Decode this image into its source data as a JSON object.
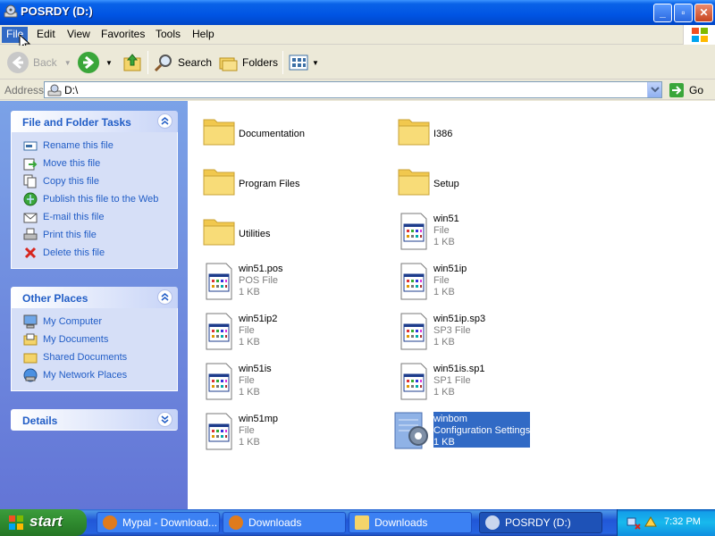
{
  "window": {
    "title": "POSRDY (D:)",
    "minimize": "_",
    "maximize": "▫",
    "close": "✕"
  },
  "menu": [
    "File",
    "Edit",
    "View",
    "Favorites",
    "Tools",
    "Help"
  ],
  "toolbar": {
    "back": "Back",
    "search": "Search",
    "folders": "Folders"
  },
  "address": {
    "label": "Address",
    "value": "D:\\",
    "go": "Go"
  },
  "panels": {
    "tasks": {
      "title": "File and Folder Tasks",
      "items": [
        "Rename this file",
        "Move this file",
        "Copy this file",
        "Publish this file to the Web",
        "E-mail this file",
        "Print this file",
        "Delete this file"
      ]
    },
    "places": {
      "title": "Other Places",
      "items": [
        "My Computer",
        "My Documents",
        "Shared Documents",
        "My Network Places"
      ]
    },
    "details": {
      "title": "Details"
    }
  },
  "files": [
    {
      "name": "Documentation",
      "kind": "folder"
    },
    {
      "name": "I386",
      "kind": "folder"
    },
    {
      "name": "Program Files",
      "kind": "folder"
    },
    {
      "name": "Setup",
      "kind": "folder"
    },
    {
      "name": "Utilities",
      "kind": "folder"
    },
    {
      "name": "win51",
      "type": "File",
      "size": "1 KB",
      "kind": "file"
    },
    {
      "name": "win51.pos",
      "type": "POS File",
      "size": "1 KB",
      "kind": "file"
    },
    {
      "name": "win51ip",
      "type": "File",
      "size": "1 KB",
      "kind": "file"
    },
    {
      "name": "win51ip2",
      "type": "File",
      "size": "1 KB",
      "kind": "file"
    },
    {
      "name": "win51ip.sp3",
      "type": "SP3 File",
      "size": "1 KB",
      "kind": "file"
    },
    {
      "name": "win51is",
      "type": "File",
      "size": "1 KB",
      "kind": "file"
    },
    {
      "name": "win51is.sp1",
      "type": "SP1 File",
      "size": "1 KB",
      "kind": "file"
    },
    {
      "name": "win51mp",
      "type": "File",
      "size": "1 KB",
      "kind": "file"
    },
    {
      "name": "winbom",
      "type": "Configuration Settings",
      "size": "1 KB",
      "kind": "config",
      "selected": true
    }
  ],
  "taskbar": {
    "start": "start",
    "buttons": [
      "Mypal - Download...",
      "Downloads",
      "Downloads",
      "POSRDY (D:)"
    ],
    "clock": "7:32 PM"
  },
  "colors": {
    "titlebar": "#0054e3",
    "selection": "#316ac5",
    "link": "#215dc6",
    "start": "#2f8a2f"
  }
}
